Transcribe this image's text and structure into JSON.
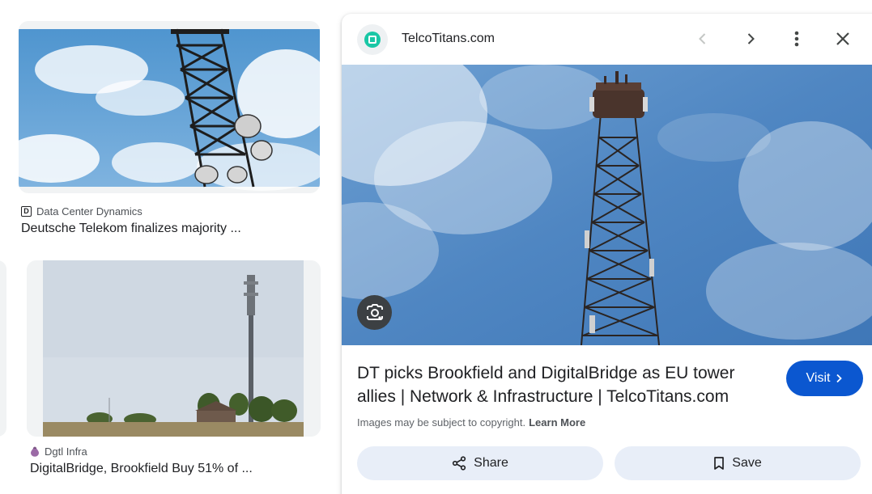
{
  "results": [
    {
      "source": "Data Center Dynamics",
      "source_icon": "letter-d-favicon",
      "title": "Deutsche Telekom finalizes majority ...",
      "image": "telecom-tower-closeup-sky"
    },
    {
      "source": "Dgtl Infra",
      "source_icon": "purple-drop-favicon",
      "title": "DigitalBridge, Brookfield Buy 51% of ...",
      "image": "cell-tower-field"
    }
  ],
  "preview": {
    "site_name": "TelcoTitans.com",
    "site_icon": "telcotitans-favicon",
    "title": "DT picks Brookfield and DigitalBridge as EU tower allies | Network & Infrastructure | TelcoTitans.com",
    "visit_label": "Visit",
    "copyright_text": "Images may be subject to copyright.",
    "learn_more_label": "Learn More",
    "share_label": "Share",
    "save_label": "Save",
    "image": "lattice-tower-blue-sky"
  },
  "colors": {
    "visit_button": "#0b57d0",
    "action_button_bg": "#e8eef8",
    "favicon_teal": "#19c7a6"
  }
}
